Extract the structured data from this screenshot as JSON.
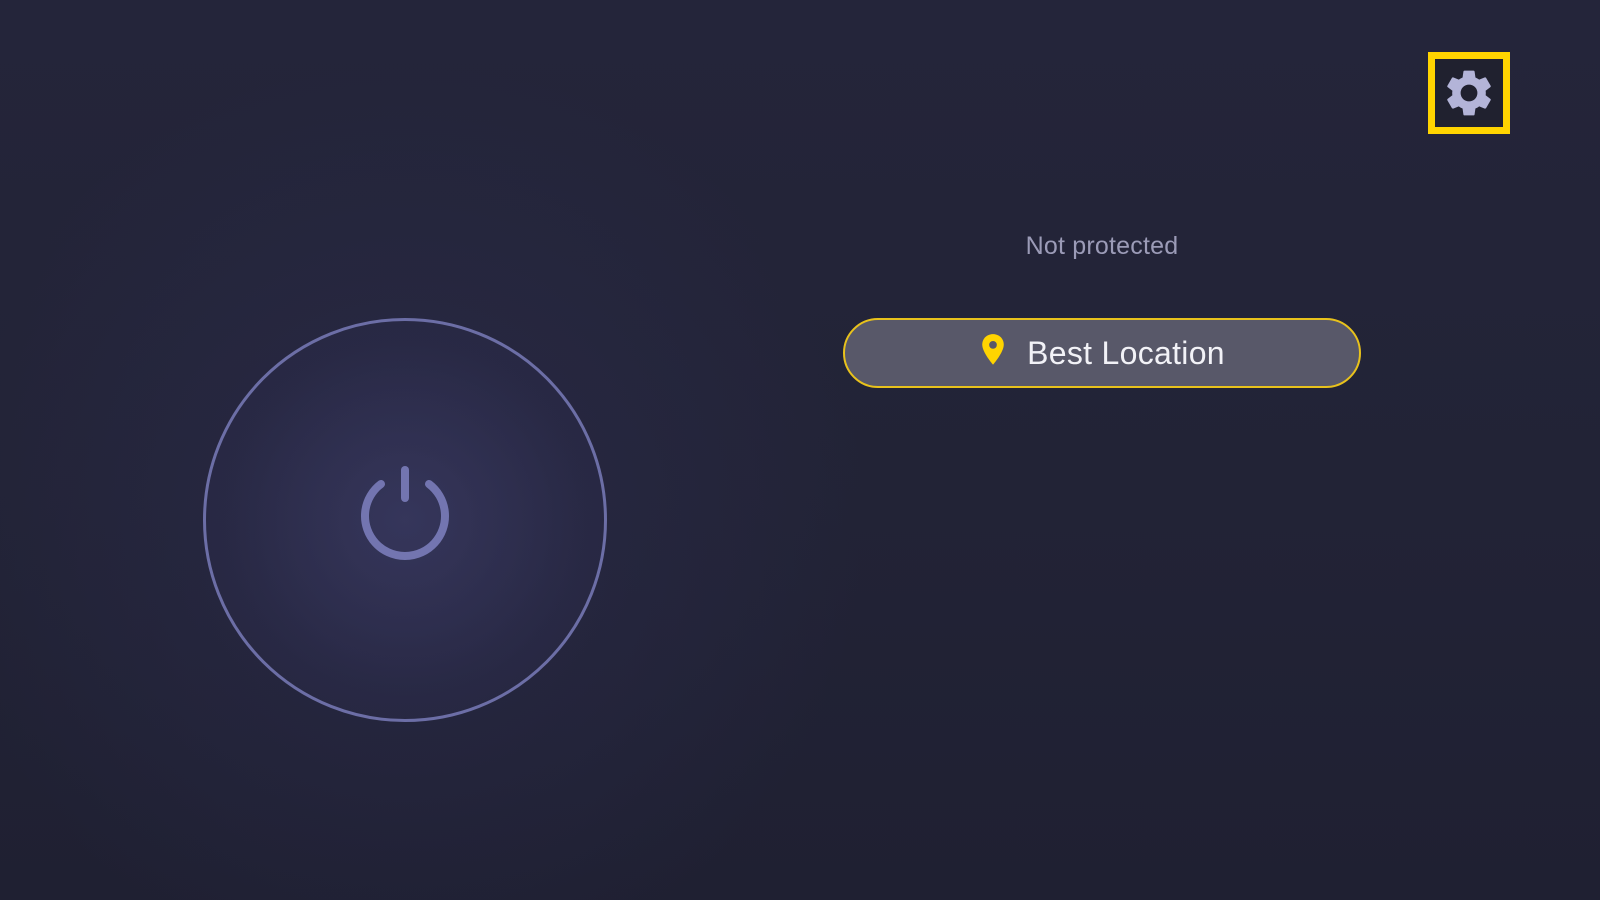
{
  "header": {
    "settings_icon": "gear-icon"
  },
  "status": {
    "text": "Not protected"
  },
  "location": {
    "icon": "location-pin-icon",
    "label": "Best Location"
  },
  "power": {
    "icon": "power-icon"
  },
  "colors": {
    "accent": "#ffd400",
    "background": "#242538",
    "ring": "#6c6ea6",
    "status_text": "#9b9bb7",
    "location_button_bg": "#585869"
  }
}
